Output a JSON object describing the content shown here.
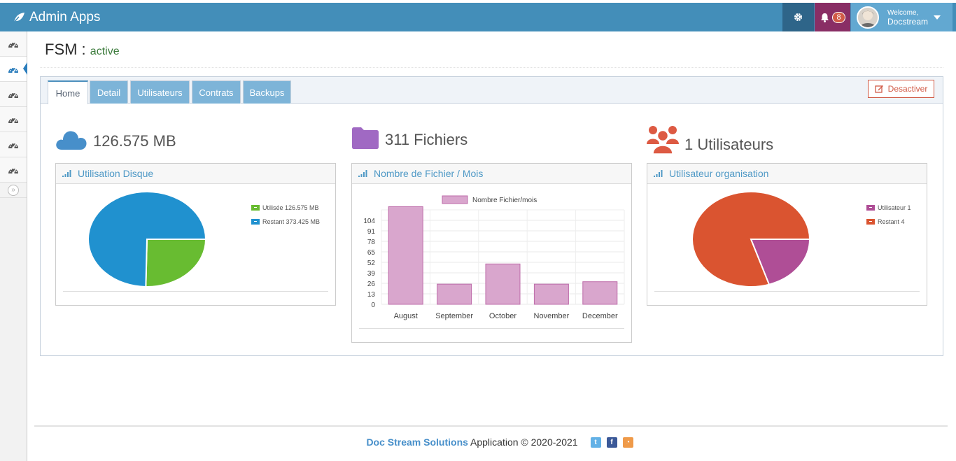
{
  "navbar": {
    "brand": "Admin Apps",
    "notifications_count": "8",
    "user_welcome": "Welcome,",
    "user_name": "Docstream"
  },
  "sidebar": {
    "items": [
      {
        "icon": "dashboard-icon",
        "active": false
      },
      {
        "icon": "dashboard-icon",
        "active": true
      },
      {
        "icon": "dashboard-icon",
        "active": false
      },
      {
        "icon": "dashboard-icon",
        "active": false
      },
      {
        "icon": "dashboard-icon",
        "active": false
      },
      {
        "icon": "dashboard-icon",
        "active": false
      }
    ],
    "collapse_icon": "double-chevron-right-icon"
  },
  "page": {
    "title": "FSM :",
    "status": "active"
  },
  "tabs": [
    "Home",
    "Detail",
    "Utilisateurs",
    "Contrats",
    "Backups"
  ],
  "active_tab": "Home",
  "deactivate_label": "Desactiver",
  "stats": {
    "disk": "126.575 MB",
    "files": "311 Fichiers",
    "users": "1 Utilisateurs"
  },
  "widgets": {
    "disk_title": "Utilisation Disque",
    "files_title": "Nombre de Fichier / Mois",
    "users_title": "Utilisateur organisation"
  },
  "colors": {
    "navbar": "#438eb9",
    "disk_used": "#68bc31",
    "disk_free": "#2091cf",
    "bar_fill": "#d9a6cd",
    "bar_stroke": "#bd6ba9",
    "user_1": "#af4e96",
    "user_rest": "#da5430"
  },
  "chart_data": [
    {
      "type": "pie",
      "labels": [
        "Utilisée 126.575 MB",
        "Restant 373.425 MB"
      ],
      "values": [
        126.575,
        373.425
      ],
      "legend": "right"
    },
    {
      "type": "bar",
      "categories": [
        "August",
        "September",
        "October",
        "November",
        "December"
      ],
      "series": [
        {
          "name": "Nombre Fichier/mois",
          "values": [
            121,
            25,
            50,
            25,
            28
          ]
        }
      ],
      "yticks": [
        0,
        13,
        26,
        39,
        52,
        65,
        78,
        91,
        104
      ],
      "ylim": [
        0,
        117
      ],
      "grid": true,
      "legend": "top"
    },
    {
      "type": "pie",
      "labels": [
        "Utilisateur 1",
        "Restant 4"
      ],
      "values": [
        1,
        4
      ],
      "legend": "right"
    }
  ],
  "footer": {
    "org": "Doc Stream Solutions",
    "text": " Application © 2020-2021",
    "social": [
      "twitter-icon",
      "facebook-icon",
      "rss-icon"
    ]
  }
}
